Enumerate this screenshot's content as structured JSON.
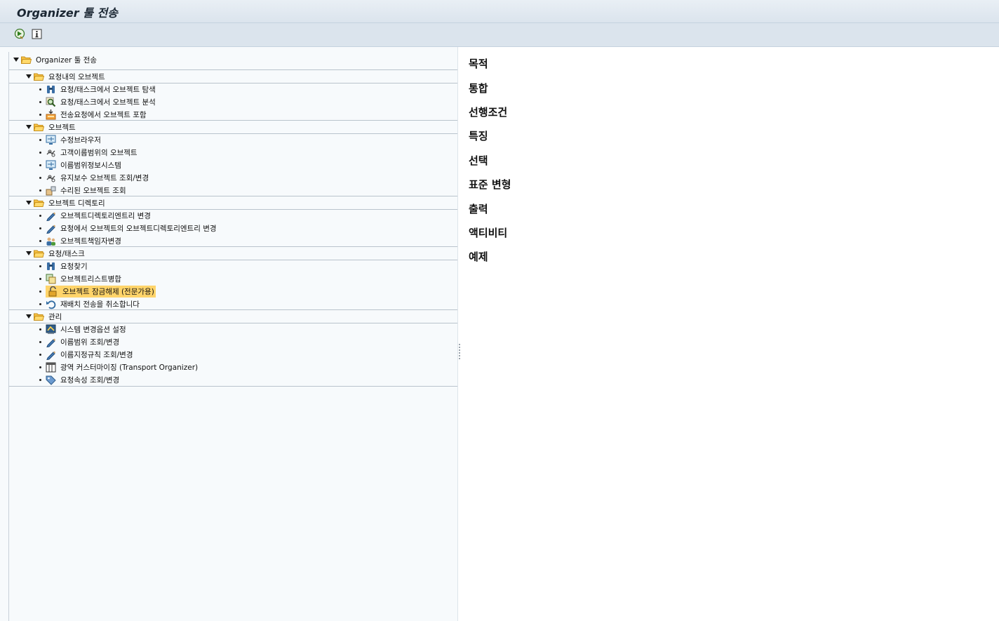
{
  "window": {
    "title": "Organizer 툴 전송"
  },
  "toolbar": {
    "execute_icon": "execute-icon",
    "info_icon": "info-icon"
  },
  "tree": {
    "root": "Organizer 툴 전송",
    "groups": [
      {
        "label": "요청내의 오브젝트",
        "items": [
          {
            "label": "요청/태스크에서 오브젝트 탐색",
            "icon": "binoculars-icon"
          },
          {
            "label": "요청/태스크에서 오브젝트 분석",
            "icon": "analyze-icon"
          },
          {
            "label": "전송요청에서 오브젝트 포함",
            "icon": "include-icon"
          }
        ]
      },
      {
        "label": "오브젝트",
        "items": [
          {
            "label": "수정브라우저",
            "icon": "monitor-icon"
          },
          {
            "label": "고객이름범위의 오브젝트",
            "icon": "link-icon"
          },
          {
            "label": "이름범위정보시스템",
            "icon": "monitor-icon"
          },
          {
            "label": "유지보수 오브젝트 조회/변경",
            "icon": "link-icon"
          },
          {
            "label": "수리된 오브젝트 조회",
            "icon": "repaired-icon"
          }
        ]
      },
      {
        "label": "오브젝트 디렉토리",
        "items": [
          {
            "label": "오브젝트디렉토리엔트리 변경",
            "icon": "pencil-icon"
          },
          {
            "label": "요청에서 오브젝트의 오브젝트디렉토리엔트리 변경",
            "icon": "pencil-icon"
          },
          {
            "label": "오브젝트책임자변경",
            "icon": "persons-icon"
          }
        ]
      },
      {
        "label": "요청/태스크",
        "items": [
          {
            "label": "요청찾기",
            "icon": "binoculars-icon"
          },
          {
            "label": "오브젝트리스트병합",
            "icon": "merge-icon"
          },
          {
            "label": "오브젝트 잠금해제 (전문가용)",
            "icon": "unlock-icon",
            "selected": true
          },
          {
            "label": "재배치 전송을 취소합니다",
            "icon": "undo-icon"
          }
        ]
      },
      {
        "label": "관리",
        "items": [
          {
            "label": "시스템 변경옵션 설정",
            "icon": "settings-icon"
          },
          {
            "label": "이름범위 조회/변경",
            "icon": "pencil-icon"
          },
          {
            "label": "이름지정규칙 조회/변경",
            "icon": "pencil-icon"
          },
          {
            "label": "광역 커스터마이징 (Transport Organizer)",
            "icon": "table-icon"
          },
          {
            "label": "요청속성 조회/변경",
            "icon": "tag-icon"
          }
        ]
      }
    ]
  },
  "doc": {
    "headings": [
      "목적",
      "통합",
      "선행조건",
      "특징",
      "선택",
      "표준 변형",
      "출력",
      "액티비티",
      "예제"
    ]
  }
}
